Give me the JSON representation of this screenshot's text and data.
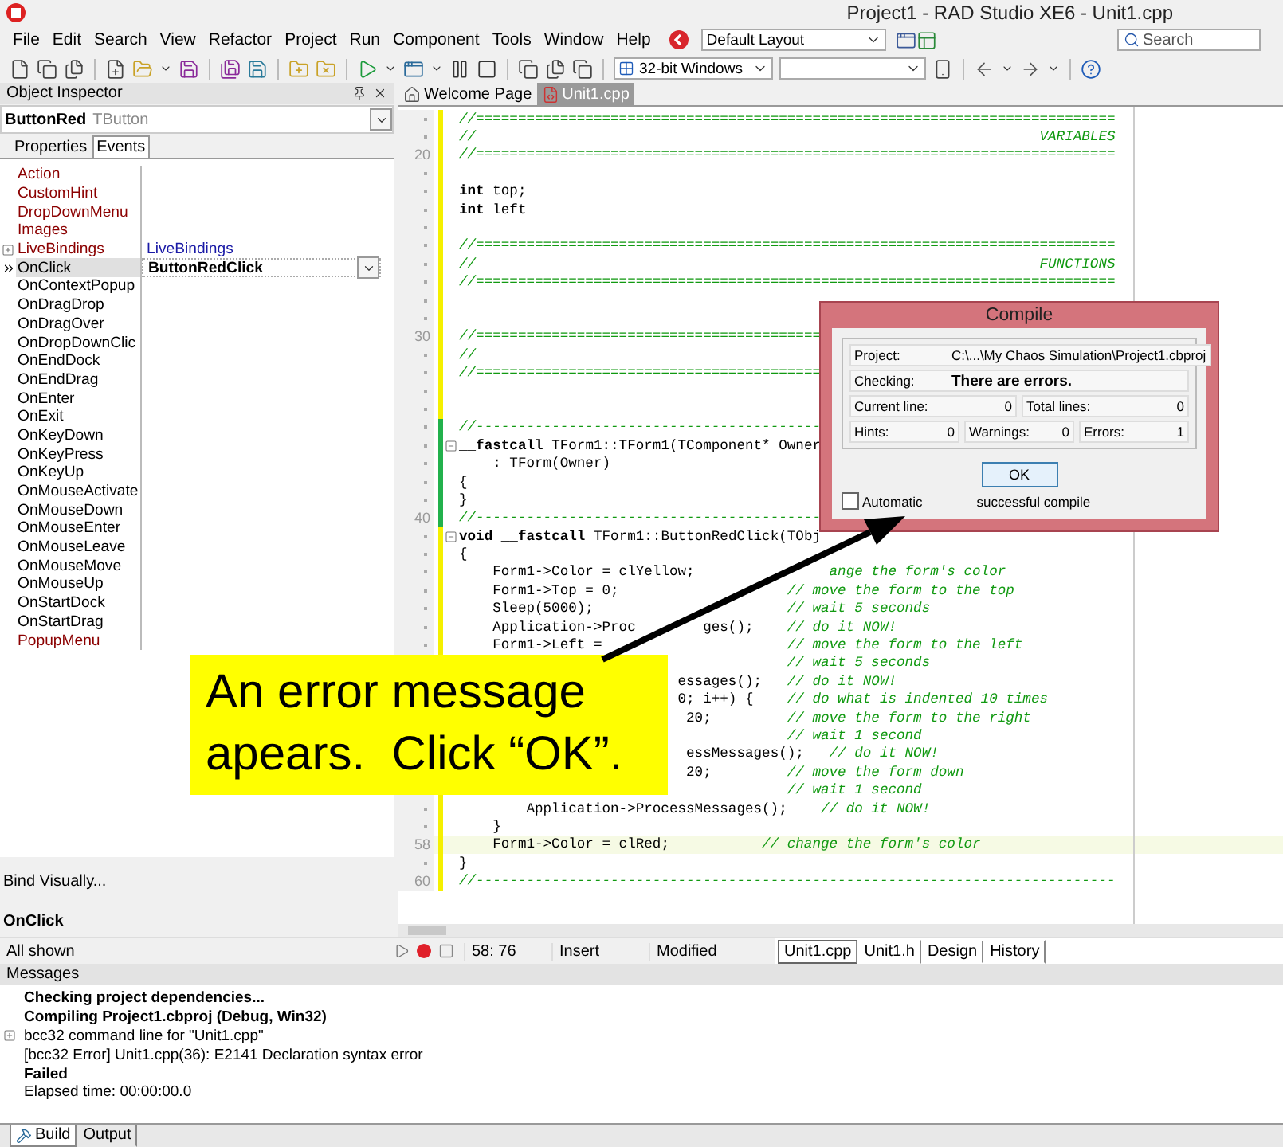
{
  "title_bar": {
    "title": "Project1 - RAD Studio XE6 - Unit1.cpp"
  },
  "menu_bar": {
    "items": [
      "File",
      "Edit",
      "Search",
      "View",
      "Refactor",
      "Project",
      "Run",
      "Component",
      "Tools",
      "Window",
      "Help"
    ],
    "layout": "Default Layout",
    "search": {
      "placeholder": "Search"
    }
  },
  "toolbar": {
    "platform": "32-bit Windows"
  },
  "object_inspector": {
    "title": "Object Inspector",
    "component": {
      "name": "ButtonRed",
      "type": "TButton"
    },
    "tabs": [
      {
        "label": "Properties",
        "selected": false
      },
      {
        "label": "Events",
        "selected": true
      }
    ],
    "events": [
      {
        "name": "Action",
        "kind": "reference",
        "selected": false
      },
      {
        "name": "CustomHint",
        "kind": "reference",
        "selected": false
      },
      {
        "name": "DropDownMenu",
        "kind": "reference",
        "selected": false
      },
      {
        "name": "Images",
        "kind": "reference",
        "selected": false
      },
      {
        "name": "LiveBindings",
        "kind": "reference",
        "value": "LiveBindings",
        "expandable": true,
        "selected": false
      },
      {
        "name": "OnClick",
        "kind": "event",
        "value": "ButtonRedClick",
        "selected": true
      },
      {
        "name": "OnContextPopup",
        "kind": "event",
        "selected": false
      },
      {
        "name": "OnDragDrop",
        "kind": "event",
        "selected": false
      },
      {
        "name": "OnDragOver",
        "kind": "event",
        "selected": false
      },
      {
        "name": "OnDropDownClic",
        "kind": "event",
        "selected": false
      },
      {
        "name": "OnEndDock",
        "kind": "event",
        "selected": false
      },
      {
        "name": "OnEndDrag",
        "kind": "event",
        "selected": false
      },
      {
        "name": "OnEnter",
        "kind": "event",
        "selected": false
      },
      {
        "name": "OnExit",
        "kind": "event",
        "selected": false
      },
      {
        "name": "OnKeyDown",
        "kind": "event",
        "selected": false
      },
      {
        "name": "OnKeyPress",
        "kind": "event",
        "selected": false
      },
      {
        "name": "OnKeyUp",
        "kind": "event",
        "selected": false
      },
      {
        "name": "OnMouseActivate",
        "kind": "event",
        "selected": false
      },
      {
        "name": "OnMouseDown",
        "kind": "event",
        "selected": false
      },
      {
        "name": "OnMouseEnter",
        "kind": "event",
        "selected": false
      },
      {
        "name": "OnMouseLeave",
        "kind": "event",
        "selected": false
      },
      {
        "name": "OnMouseMove",
        "kind": "event",
        "selected": false
      },
      {
        "name": "OnMouseUp",
        "kind": "event",
        "selected": false
      },
      {
        "name": "OnStartDock",
        "kind": "event",
        "selected": false
      },
      {
        "name": "OnStartDrag",
        "kind": "event",
        "selected": false
      },
      {
        "name": "PopupMenu",
        "kind": "reference",
        "selected": false
      }
    ],
    "bind_visually": "Bind Visually...",
    "selected_event": "OnClick",
    "filter": "All shown"
  },
  "editor": {
    "tabs": [
      {
        "label": "Welcome Page",
        "selected": false
      },
      {
        "label": "Unit1.cpp",
        "selected": true
      }
    ],
    "lines": [
      {
        "modified": true,
        "comment": "//============================================================================"
      },
      {
        "modified": true,
        "comment": "//                                                                   VARIABLES"
      },
      {
        "number": "20",
        "modified": true,
        "comment": "//============================================================================"
      },
      {
        "modified": true
      },
      {
        "modified": true,
        "code": "**int** top;"
      },
      {
        "modified": true,
        "code": "**int** left"
      },
      {
        "modified": true
      },
      {
        "modified": true,
        "comment": "//============================================================================"
      },
      {
        "modified": true,
        "comment": "//                                                                   FUNCTIONS"
      },
      {
        "modified": true,
        "comment": "//============================================================================"
      },
      {
        "modified": true
      },
      {
        "modified": true
      },
      {
        "number": "30",
        "modified": true,
        "comment": "//========================================="
      },
      {
        "modified": true,
        "comment": "//"
      },
      {
        "modified": true,
        "comment": "//========================================="
      },
      {
        "modified": true
      },
      {
        "modified": true
      },
      {
        "modified": false,
        "comment": "//-----------------------------------------"
      },
      {
        "modified": false,
        "fold": true,
        "code": "**__fastcall** TForm1::TForm1(TComponent* Owner"
      },
      {
        "modified": false,
        "code": "    : TForm(Owner)"
      },
      {
        "modified": false,
        "code": "{"
      },
      {
        "modified": false,
        "code": "}"
      },
      {
        "number": "40",
        "modified": false,
        "comment": "//-----------------------------------------"
      },
      {
        "modified": true,
        "fold": true,
        "code": "**void** **__fastcall** TForm1::ButtonRedClick(TObj"
      },
      {
        "modified": true,
        "code": "{"
      },
      {
        "modified": true,
        "code": "    Form1->Color = clYellow;",
        "comment": "                ange the form's color"
      },
      {
        "modified": true,
        "code": "    Form1->Top = 0;",
        "comment": "                    // move the form to the top"
      },
      {
        "modified": true,
        "code": "    Sleep(5000);",
        "comment": "                       // wait 5 seconds"
      },
      {
        "modified": true,
        "code": "    Application->Proc",
        "code_after": "        ges();",
        "comment": "    // do it NOW!"
      },
      {
        "modified": true,
        "code": "    Form1->Left =",
        "comment": "                      // move the form to the left"
      },
      {
        "modified": true,
        "comment": "                                       // wait 5 seconds"
      },
      {
        "code": "                          essages();",
        "comment": "   // do it NOW!"
      },
      {
        "code": "                          0; i++) {",
        "comment": "    // do what is indented 10 times"
      },
      {
        "code": "                           20;",
        "comment": "         // move the form to the right"
      },
      {
        "comment": "                                       // wait 1 second"
      },
      {
        "code": "                           essMessages();",
        "comment": "   // do it NOW!"
      },
      {
        "code": "                           20;",
        "comment": "         // move the form down"
      },
      {
        "modified": true,
        "comment": "                                       // wait 1 second"
      },
      {
        "modified": true,
        "code": "        Application->ProcessMessages();",
        "comment": "    // do it NOW!"
      },
      {
        "modified": true,
        "code": "    }"
      },
      {
        "number": "58",
        "modified": true,
        "current": true,
        "code": "    Form1->Color = clRed;",
        "comment": "           // change the form's color"
      },
      {
        "modified": true,
        "code": "}"
      },
      {
        "number": "60",
        "modified": true,
        "comment": "//----------------------------------------------------------------------------"
      }
    ],
    "status": {
      "position": "58: 76",
      "mode": "Insert",
      "state": "Modified"
    },
    "view_tabs": [
      {
        "label": "Unit1.cpp",
        "selected": true
      },
      {
        "label": "Unit1.h",
        "selected": false
      },
      {
        "label": "Design",
        "selected": false
      },
      {
        "label": "History",
        "selected": false
      }
    ]
  },
  "messages": {
    "title": "Messages",
    "lines": [
      {
        "text": "Checking project dependencies...",
        "bold": true
      },
      {
        "text": "Compiling Project1.cbproj (Debug, Win32)",
        "bold": true
      },
      {
        "text": "bcc32 command line for \"Unit1.cpp\"",
        "bold": false,
        "expandable": true
      },
      {
        "text": "[bcc32 Error] Unit1.cpp(36): E2141 Declaration syntax error",
        "bold": false
      },
      {
        "text": "Failed",
        "bold": true
      },
      {
        "text": "Elapsed time: 00:00:00.0",
        "bold": false
      }
    ],
    "tabs": [
      {
        "label": "Build",
        "selected": true
      },
      {
        "label": "Output",
        "selected": false
      }
    ]
  },
  "compile_dialog": {
    "title": "Compile",
    "rows": [
      [
        {
          "label": "Project:",
          "value": "C:\\...\\My Chaos Simulation\\Project1.cbproj",
          "kind": "path"
        }
      ],
      [
        {
          "label": "Checking:",
          "value": "There are errors.",
          "kind": "status"
        }
      ],
      [
        {
          "label": "Current line:",
          "value": "0",
          "kind": "count"
        },
        {
          "label": "Total lines:",
          "value": "0",
          "kind": "count"
        }
      ],
      [
        {
          "label": "Hints:",
          "value": "0",
          "kind": "count"
        },
        {
          "label": "Warnings:",
          "value": "0",
          "kind": "count"
        },
        {
          "label": "Errors:",
          "value": "1",
          "kind": "count"
        }
      ]
    ],
    "ok": "OK",
    "auto_close": {
      "label_start": "Automatic",
      "label_end": "successful compile",
      "checked": false
    }
  },
  "callout": {
    "text": "An error message apears.  Click “OK”."
  }
}
